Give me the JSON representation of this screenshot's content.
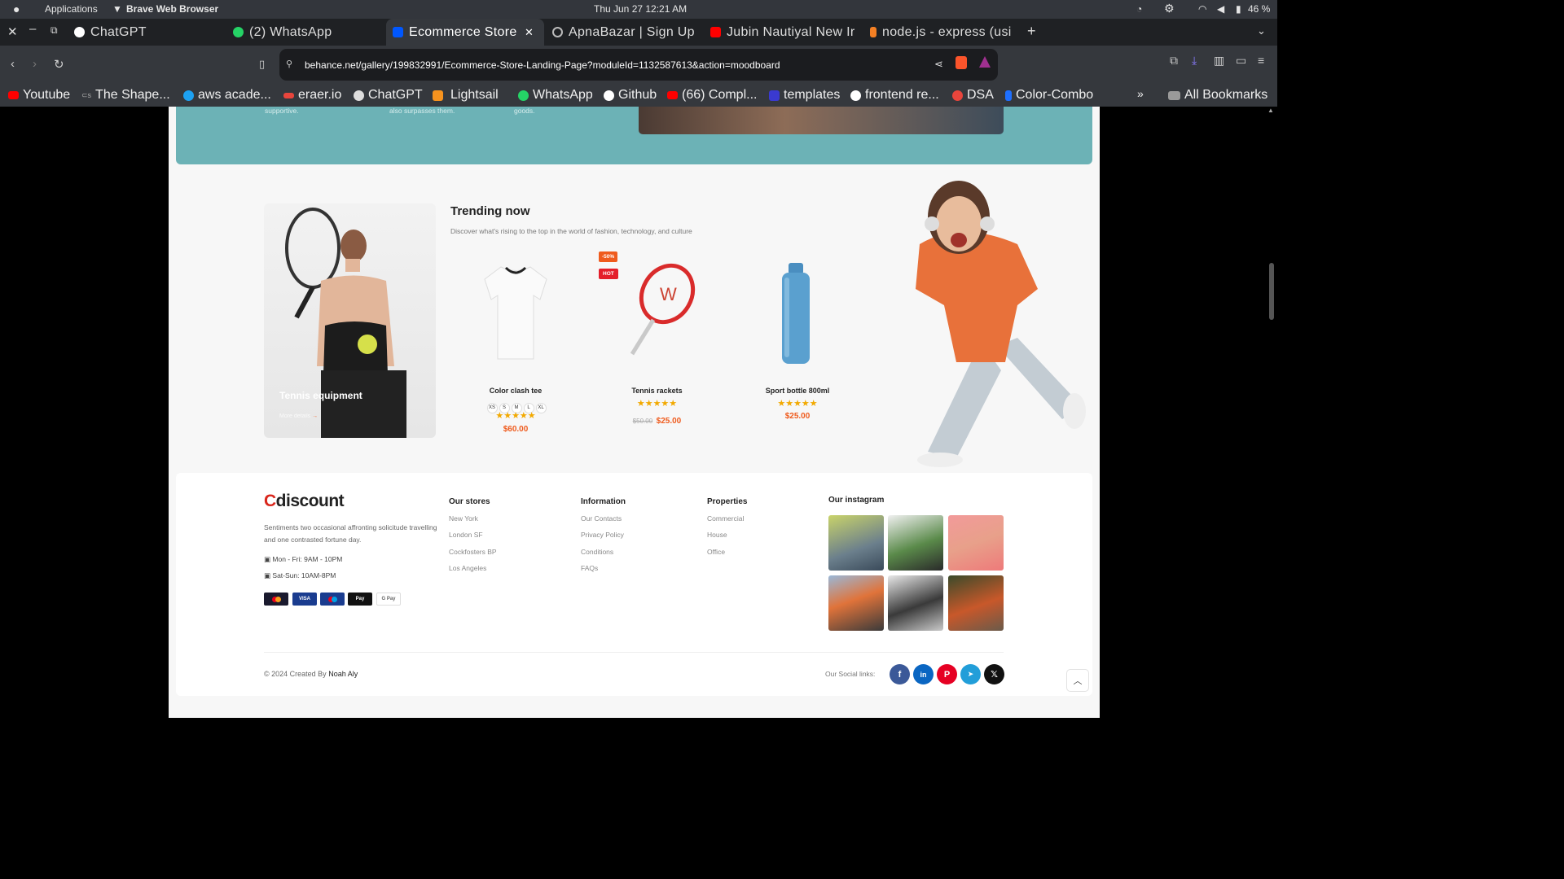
{
  "system_bar": {
    "app_menu": "Applications",
    "app_name": "Brave Web Browser",
    "datetime": "Thu Jun 27  12:21  AM",
    "battery": "46 %"
  },
  "tabs": [
    {
      "label": "ChatGPT",
      "icon": "chatgpt-icon"
    },
    {
      "label": "(2)  WhatsApp",
      "icon": "whatsapp-icon"
    },
    {
      "label": "Ecommerce  Store  |",
      "icon": "behance-icon",
      "active": true
    },
    {
      "label": "ApnaBazar  |  Sign  Up",
      "icon": "globe-icon"
    },
    {
      "label": "Jubin  Nautiyal  New  Ir",
      "icon": "youtube-icon"
    },
    {
      "label": "node.js  -  express  (usi",
      "icon": "stackoverflow-icon"
    }
  ],
  "address_bar": {
    "url": "behance.net/gallery/199832991/Ecommerce-Store-Landing-Page?moduleId=1132587613&action=moodboard"
  },
  "bookmarks": [
    "Youtube",
    "The  Shape...",
    "aws  acade...",
    "eraer.io",
    "ChatGPT",
    "Lightsail",
    "WhatsApp",
    "Github",
    "(66)  Compl...",
    "templates",
    "frontend  re...",
    "DSA",
    "Color-Combo"
  ],
  "bookmarks_right": "All  Bookmarks",
  "teal_section": {
    "captions": [
      "supportive.",
      "also surpasses them.",
      "goods."
    ]
  },
  "promo_card": {
    "title": "Tennis equipment",
    "link": "More details"
  },
  "trending": {
    "title": "Trending now",
    "subtitle": "Discover what's rising to the top in the world of fashion, technology, and culture",
    "products": [
      {
        "name": "Color clash tee",
        "sizes": [
          "XS",
          "S",
          "M",
          "L",
          "XL"
        ],
        "rating": 5,
        "price": "$60.00"
      },
      {
        "name": "Tennis rackets",
        "badges": [
          "-50%",
          "HOT"
        ],
        "rating": 5,
        "old_price": "$50.00",
        "price": "$25.00"
      },
      {
        "name": "Sport bottle 800ml",
        "rating": 5,
        "price": "$25.00"
      }
    ]
  },
  "footer": {
    "logo_c": "C",
    "logo_rest": "discount",
    "description": "Sentiments two occasional affronting solicitude travelling and one contrasted fortune day.",
    "hours": [
      "Mon - Fri: 9AM - 10PM",
      "Sat-Sun: 10AM-8PM"
    ],
    "payments": [
      "mastercard",
      "VISA",
      "maestro",
      "Pay",
      "G Pay"
    ],
    "stores": {
      "title": "Our stores",
      "items": [
        "New York",
        "London SF",
        "Cockfosters BP",
        "Los Angeles"
      ]
    },
    "information": {
      "title": "Information",
      "items": [
        "Our Contacts",
        "Privacy Policy",
        "Conditions",
        "FAQs"
      ]
    },
    "properties": {
      "title": "Properties",
      "items": [
        "Commercial",
        "House",
        "Office"
      ]
    },
    "instagram": {
      "title": "Our instagram"
    },
    "copyright_prefix": "© 2024 Created By",
    "copyright_name": "Noah Aly",
    "social_label": "Our Social links:",
    "social": [
      {
        "icon": "f",
        "color": "#3b5998"
      },
      {
        "icon": "in",
        "color": "#0a66c2"
      },
      {
        "icon": "P",
        "color": "#e60023"
      },
      {
        "icon": "➤",
        "color": "#229ed9"
      },
      {
        "icon": "𝕏",
        "color": "#111111"
      }
    ]
  }
}
